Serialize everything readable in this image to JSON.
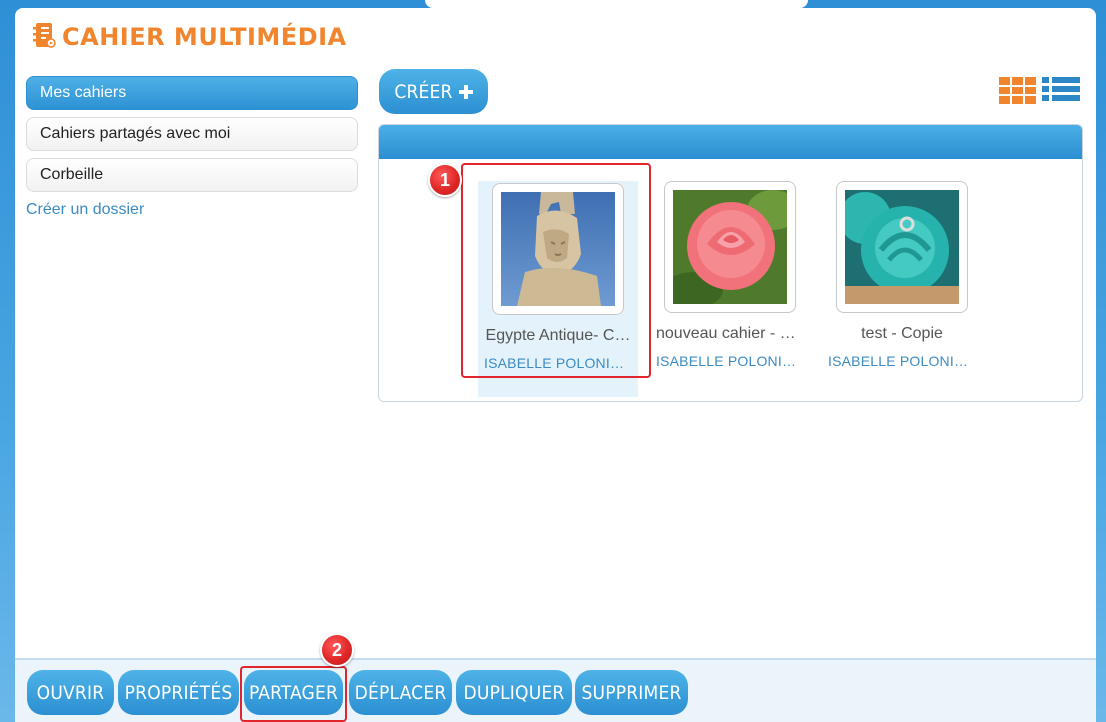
{
  "app": {
    "title": "CAHIER MULTIMÉDIA",
    "logo_icon": "notebook-icon"
  },
  "sidebar": {
    "items": [
      {
        "label": "Mes cahiers",
        "active": true
      },
      {
        "label": "Cahiers partagés avec moi",
        "active": false
      },
      {
        "label": "Corbeille",
        "active": false
      }
    ],
    "create_folder_link": "Créer un dossier"
  },
  "toolbar": {
    "create_label": "CRÉER",
    "create_icon": "plus-icon",
    "grid_view_icon": "grid-view-icon",
    "list_view_icon": "list-view-icon"
  },
  "notebooks": [
    {
      "title": "Egypte Antique- C…",
      "author": "ISABELLE POLONIO…",
      "thumbnail": "pharaoh-statue-thumbnail",
      "selected": true
    },
    {
      "title": "nouveau cahier - C…",
      "author": "ISABELLE POLONIO …",
      "thumbnail": "pink-rose-thumbnail",
      "selected": false
    },
    {
      "title": "test - Copie",
      "author": "ISABELLE POLONIO …",
      "thumbnail": "turquoise-cupcake-thumbnail",
      "selected": false
    }
  ],
  "actions": {
    "open": "OUVRIR",
    "properties": "PROPRIÉTÉS",
    "share": "PARTAGER",
    "move": "DÉPLACER",
    "duplicate": "DUPLIQUER",
    "delete": "SUPPRIMER"
  },
  "annotations": {
    "step1": "1",
    "step2": "2"
  },
  "colors": {
    "accent_orange": "#f0852d",
    "primary_blue": "#2d92d4",
    "link_blue": "#3b8bc4",
    "callout_red": "#e0262c"
  }
}
